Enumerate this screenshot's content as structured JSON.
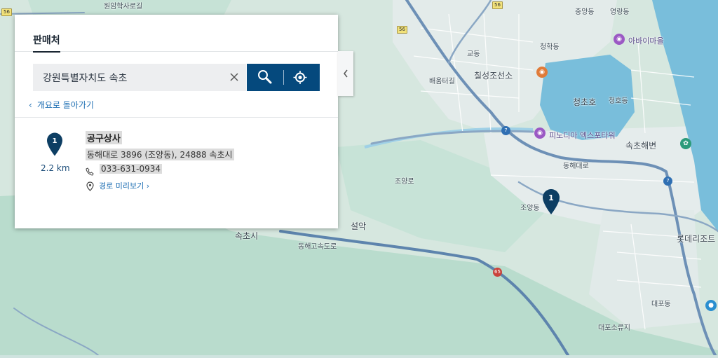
{
  "panel": {
    "tab_label": "판매처",
    "search": {
      "value": "강원특별자치도 속초",
      "placeholder": ""
    },
    "back_label": "개요로 돌아가기",
    "result": {
      "index": "1",
      "distance": "2.2 km",
      "name": "공구상사",
      "address": "동해대로 3896 (조양동), 24888 속초시",
      "phone": "033-631-0934",
      "route_label": "경로 미리보기"
    }
  },
  "icons": {
    "clear": "close-icon",
    "search": "search-icon",
    "locate": "crosshair-icon",
    "back": "chevron-left-icon",
    "phone": "phone-icon",
    "route": "map-pin-icon",
    "collapse": "chevron-left-icon"
  },
  "map": {
    "marker_label": "1",
    "labels": [
      "원암학사로길",
      "중앙동",
      "영랑동",
      "아바이마을",
      "청학동",
      "칠성조선소",
      "배움터길",
      "청초호",
      "피노디아 엑스포타워",
      "속초해변",
      "조양로",
      "조양동",
      "속초시",
      "동해고속도로",
      "롯데리조트",
      "설악",
      "대포동",
      "대포소류지",
      "교동",
      "동해대로",
      "청호동"
    ],
    "shields": [
      "56",
      "56",
      "56",
      "7",
      "7",
      "65"
    ]
  },
  "colors": {
    "brand_blue": "#05497d",
    "link_blue": "#1e6fb3",
    "water": "#79bedb",
    "land": "#d3e6de",
    "forest": "#b9dccd"
  }
}
